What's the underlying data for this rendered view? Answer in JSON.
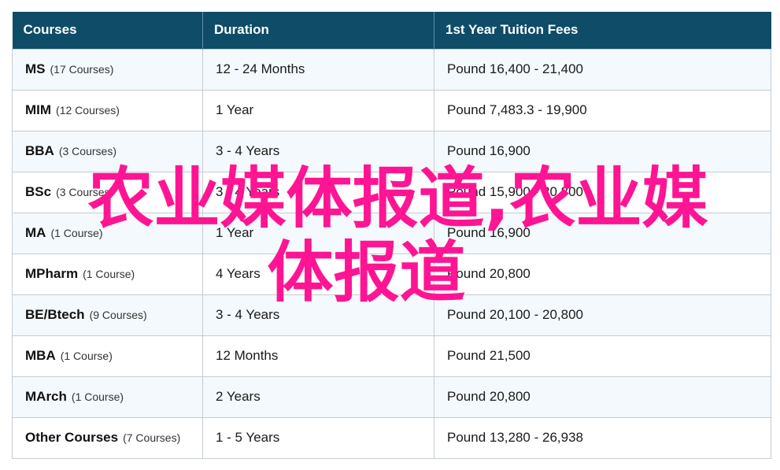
{
  "table": {
    "headers": [
      "Courses",
      "Duration",
      "1st Year Tuition Fees"
    ],
    "rows": [
      {
        "course": "MS",
        "count": "(17 Courses)",
        "duration": "12 - 24 Months",
        "fees": "Pound 16,400 - 21,400"
      },
      {
        "course": "MIM",
        "count": "(12 Courses)",
        "duration": "1 Year",
        "fees": "Pound 7,483.3 - 19,900"
      },
      {
        "course": "BBA",
        "count": "(3 Courses)",
        "duration": "3 - 4 Years",
        "fees": "Pound 16,900"
      },
      {
        "course": "BSc",
        "count": "(3 Courses)",
        "duration": "3 - 4 Years",
        "fees": "Pound 15,900 - 20,800"
      },
      {
        "course": "MA",
        "count": "(1 Course)",
        "duration": "1 Year",
        "fees": "Pound 16,900"
      },
      {
        "course": "MPharm",
        "count": "(1 Course)",
        "duration": "4 Years",
        "fees": "Pound 20,800"
      },
      {
        "course": "BE/Btech",
        "count": "(9 Courses)",
        "duration": "3 - 4 Years",
        "fees": "Pound 20,100 - 20,800"
      },
      {
        "course": "MBA",
        "count": "(1 Course)",
        "duration": "12 Months",
        "fees": "Pound 21,500"
      },
      {
        "course": "MArch",
        "count": "(1 Course)",
        "duration": "2 Years",
        "fees": "Pound 20,800"
      },
      {
        "course": "Other Courses",
        "count": "(7 Courses)",
        "duration": "1 - 5 Years",
        "fees": "Pound 13,280 - 26,938"
      }
    ]
  },
  "overlay": {
    "line1": "农业媒体报道,农业媒",
    "line2": "体报道",
    "color": "#ff1493"
  },
  "colors": {
    "header_bg": "#0f4c68",
    "row_alt_bg": "#f3f9fd",
    "border": "#c4ccd1"
  }
}
